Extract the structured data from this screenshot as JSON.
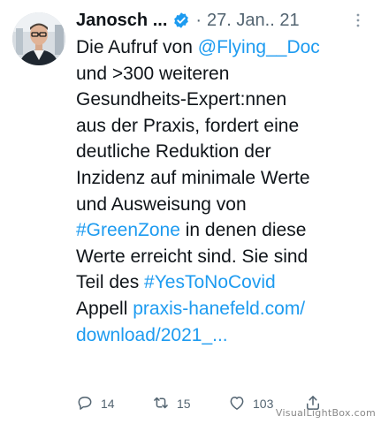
{
  "author": {
    "name": "Janosch ...",
    "verified": true,
    "avatar": "profile-photo-man-glasses"
  },
  "meta": {
    "separator": "·",
    "date": "27. Jan.. 21"
  },
  "tweet": {
    "lines": [
      [
        {
          "t": "Die Aufruf von ",
          "link": false
        },
        {
          "t": "@Flying__Doc",
          "link": true
        }
      ],
      [
        {
          "t": "und >300 weiteren",
          "link": false
        }
      ],
      [
        {
          "t": "Gesundheits-Expert:nnen",
          "link": false
        }
      ],
      [
        {
          "t": "aus der Praxis, fordert eine",
          "link": false
        }
      ],
      [
        {
          "t": "deutliche Reduktion der",
          "link": false
        }
      ],
      [
        {
          "t": "Inzidenz auf minimale Werte",
          "link": false
        }
      ],
      [
        {
          "t": "und Ausweisung von",
          "link": false
        }
      ],
      [
        {
          "t": "#GreenZone",
          "link": true
        },
        {
          "t": " in denen diese",
          "link": false
        }
      ],
      [
        {
          "t": "Werte erreicht sind. Sie sind",
          "link": false
        }
      ],
      [
        {
          "t": "Teil des ",
          "link": false
        },
        {
          "t": "#YesToNoCovid",
          "link": true
        }
      ],
      [
        {
          "t": "Appell ",
          "link": false
        },
        {
          "t": "praxis-hanefeld.com/",
          "link": true
        }
      ],
      [
        {
          "t": "download/2021_...",
          "link": true
        }
      ]
    ]
  },
  "actions": {
    "reply_count": "14",
    "retweet_count": "15",
    "like_count": "103"
  },
  "icons": {
    "more": "more-options-icon",
    "reply": "reply-icon",
    "retweet": "retweet-icon",
    "like": "like-icon",
    "share": "share-icon",
    "verified": "verified-badge-icon"
  },
  "watermark": "VisualLightBox.com",
  "colors": {
    "link": "#1d9bf0",
    "text": "#0f1419",
    "muted": "#536471",
    "verified": "#1d9bf0"
  }
}
